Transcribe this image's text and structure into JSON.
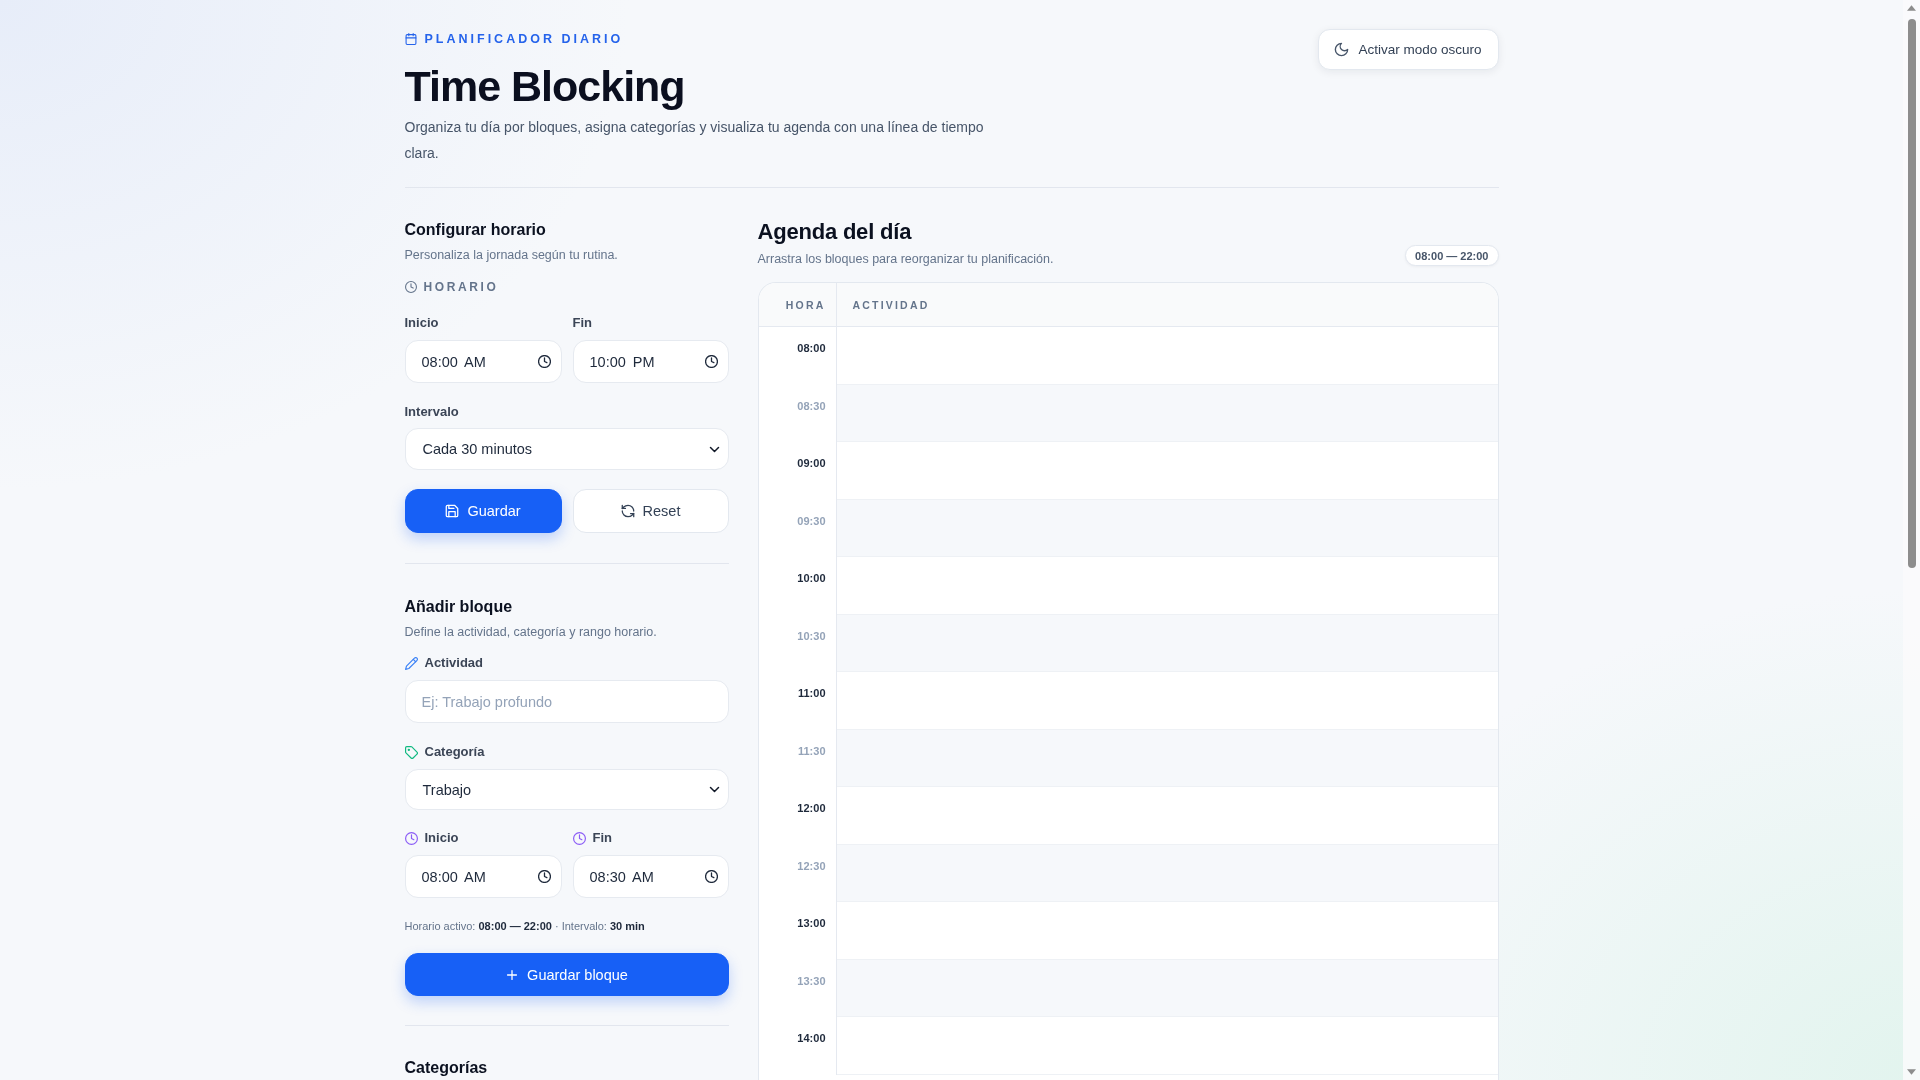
{
  "header": {
    "eyebrow": "PLANIFICADOR DIARIO",
    "title": "Time Blocking",
    "subtitle": "Organiza tu día por bloques, asigna categorías y visualiza tu agenda con una línea de tiempo clara.",
    "theme_button": "Activar modo oscuro"
  },
  "schedule_settings": {
    "title": "Configurar horario",
    "subtitle": "Personaliza la jornada según tu rutina.",
    "section_label": "HORARIO",
    "start": {
      "label": "Inicio",
      "value": "08:00 AM"
    },
    "end": {
      "label": "Fin",
      "value": "10:00 PM"
    },
    "interval": {
      "label": "Intervalo",
      "value": "Cada 30 minutos"
    },
    "buttons": [
      {
        "label": "Guardar",
        "kind": "primary"
      },
      {
        "label": "Reset",
        "kind": "secondary"
      }
    ]
  },
  "add_block": {
    "title": "Añadir bloque",
    "subtitle": "Define la actividad, categoría y rango horario.",
    "activity": {
      "label": "Actividad",
      "placeholder": "Ej: Trabajo profundo"
    },
    "category": {
      "label": "Categoría",
      "value": "Trabajo"
    },
    "start": {
      "label": "Inicio",
      "value": "08:00 AM"
    },
    "end": {
      "label": "Fin",
      "value": "08:30 AM"
    },
    "summary": "Horario activo: **08:00 — 22:00** · Intervalo: **30 min**",
    "submit_button": "Guardar bloque"
  },
  "categories": {
    "title": "Categorías"
  },
  "agenda": {
    "title": "Agenda del día",
    "subtitle": "Arrastra los bloques para reorganizar tu planificación.",
    "range_badge": "08:00 — 22:00",
    "columns": [
      "HORA",
      "ACTIVIDAD"
    ],
    "rows": [
      {
        "time": "08:00",
        "kind": "hour"
      },
      {
        "time": "08:30",
        "kind": "half"
      },
      {
        "time": "09:00",
        "kind": "hour"
      },
      {
        "time": "09:30",
        "kind": "half"
      },
      {
        "time": "10:00",
        "kind": "hour"
      },
      {
        "time": "10:30",
        "kind": "half"
      },
      {
        "time": "11:00",
        "kind": "hour"
      },
      {
        "time": "11:30",
        "kind": "half"
      },
      {
        "time": "12:00",
        "kind": "hour"
      },
      {
        "time": "12:30",
        "kind": "half"
      },
      {
        "time": "13:00",
        "kind": "hour"
      },
      {
        "time": "13:30",
        "kind": "half"
      },
      {
        "time": "14:00",
        "kind": "hour"
      }
    ]
  }
}
